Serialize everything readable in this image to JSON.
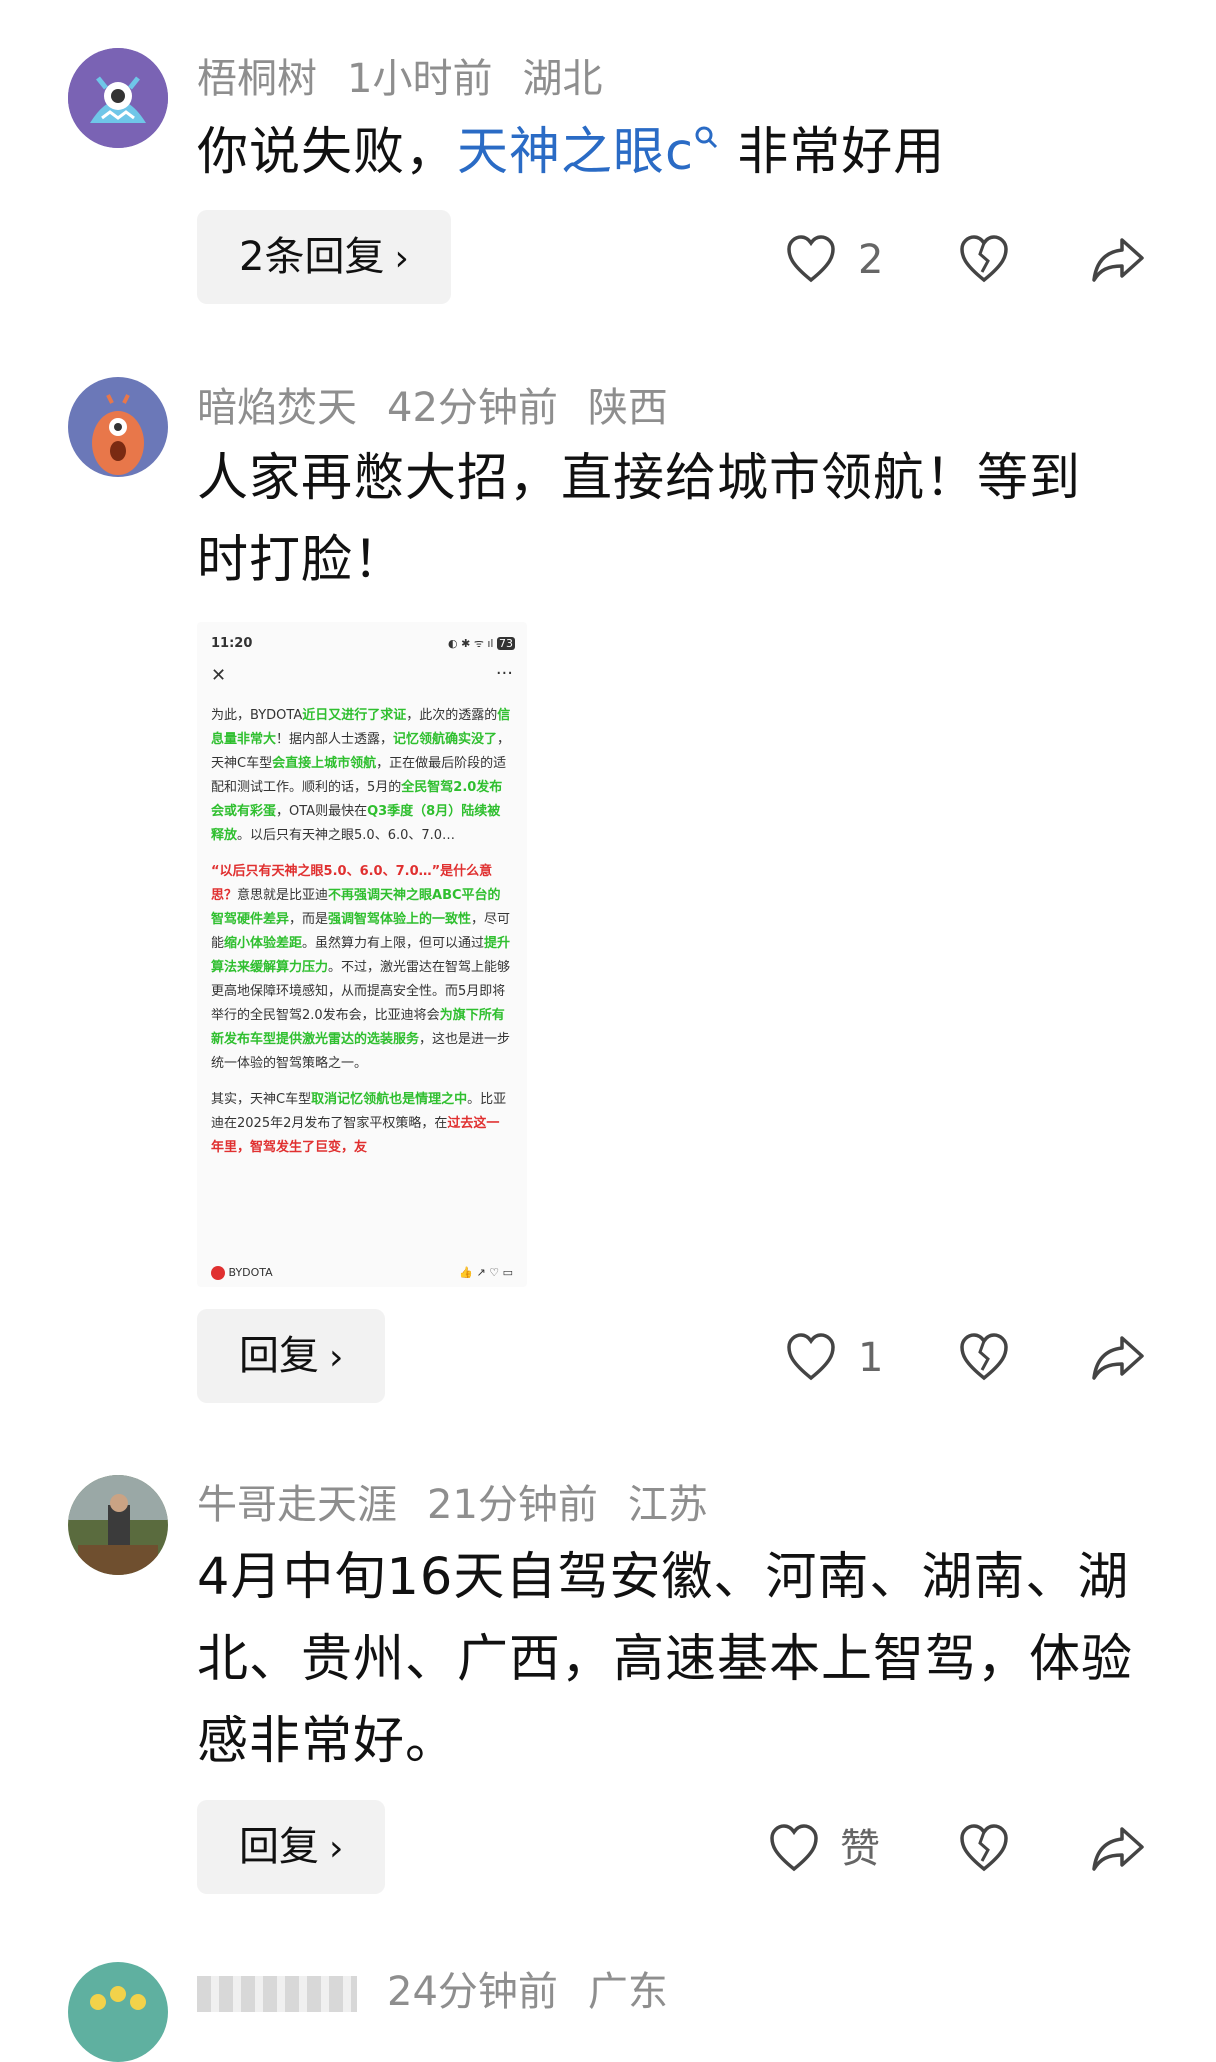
{
  "comments": [
    {
      "username": "梧桐树",
      "time": "1小时前",
      "location": "湖北",
      "text_before": "你说失败，",
      "link_text": "天神之眼c",
      "text_after": " 非常好用",
      "reply_label": "2条回复",
      "like_count": "2"
    },
    {
      "username": "暗焰焚天",
      "time": "42分钟前",
      "location": "陕西",
      "text": "人家再憋大招，直接给城市领航！等到时打脸！",
      "reply_label": "回复",
      "like_count": "1",
      "screenshot": {
        "status_time": "11:20",
        "battery": "73",
        "para1_a": "为此，BYDOTA",
        "para1_b": "近日又进行了求证",
        "para1_c": "，此次的透露的",
        "para1_d": "信息量非常大",
        "para1_e": "！据内部人士透露，",
        "para1_f": "记忆领航确实没了",
        "para1_g": "，天神C车型",
        "para1_h": "会直接上城市领航",
        "para1_i": "，正在做最后阶段的适配和测试工作。顺利的话，5月的",
        "para1_j": "全民智驾2.0发布会或有彩蛋",
        "para1_k": "，OTA则最快在",
        "para1_l": "Q3季度（8月）陆续被释放",
        "para1_m": "。以后只有天神之眼5.0、6.0、7.0…",
        "para2_a": "“以后只有天神之眼5.0、6.0、7.0…”是什么意思？",
        "para2_b": "意思就是比亚迪",
        "para2_c": "不再强调天神之眼ABC平台的智驾硬件差异",
        "para2_d": "，而是",
        "para2_e": "强调智驾体验上的一致性",
        "para2_f": "，尽可能",
        "para2_g": "缩小体验差距",
        "para2_h": "。虽然算力有上限，但可以通过",
        "para2_i": "提升算法来缓解算力压力",
        "para2_j": "。不过，激光雷达在智驾上能够更高地保障环境感知，从而提高安全性。而5月即将举行的全民智驾2.0发布会，比亚迪将会",
        "para2_k": "为旗下所有新发布车型提供激光雷达的选装服务",
        "para2_l": "，这也是进一步统一体验的智驾策略之一。",
        "para3_a": "其实，天神C车型",
        "para3_b": "取消记忆领航也是情理之中",
        "para3_c": "。比亚迪在2025年2月发布了智家平权策略，在",
        "para3_d": "过去这一年里，智驾发生了巨变，友",
        "author": "BYDOTA"
      }
    },
    {
      "username": "牛哥走天涯",
      "time": "21分钟前",
      "location": "江苏",
      "text": "4月中旬16天自驾安徽、河南、湖南、湖北、贵州、广西，高速基本上智驾，体验感非常好。",
      "reply_label": "回复",
      "like_label": "赞"
    },
    {
      "username": "",
      "time": "24分钟前",
      "location": "广东"
    }
  ],
  "icons": {
    "like": "heart-icon",
    "dislike": "broken-heart-icon",
    "share": "share-icon",
    "search": "search-icon",
    "chevron": "chevron-right-icon"
  },
  "colors": {
    "link": "#2a6bc5",
    "meta": "#8e8e8e",
    "highlight_green": "#2fbf2f",
    "highlight_red": "#e03030"
  }
}
